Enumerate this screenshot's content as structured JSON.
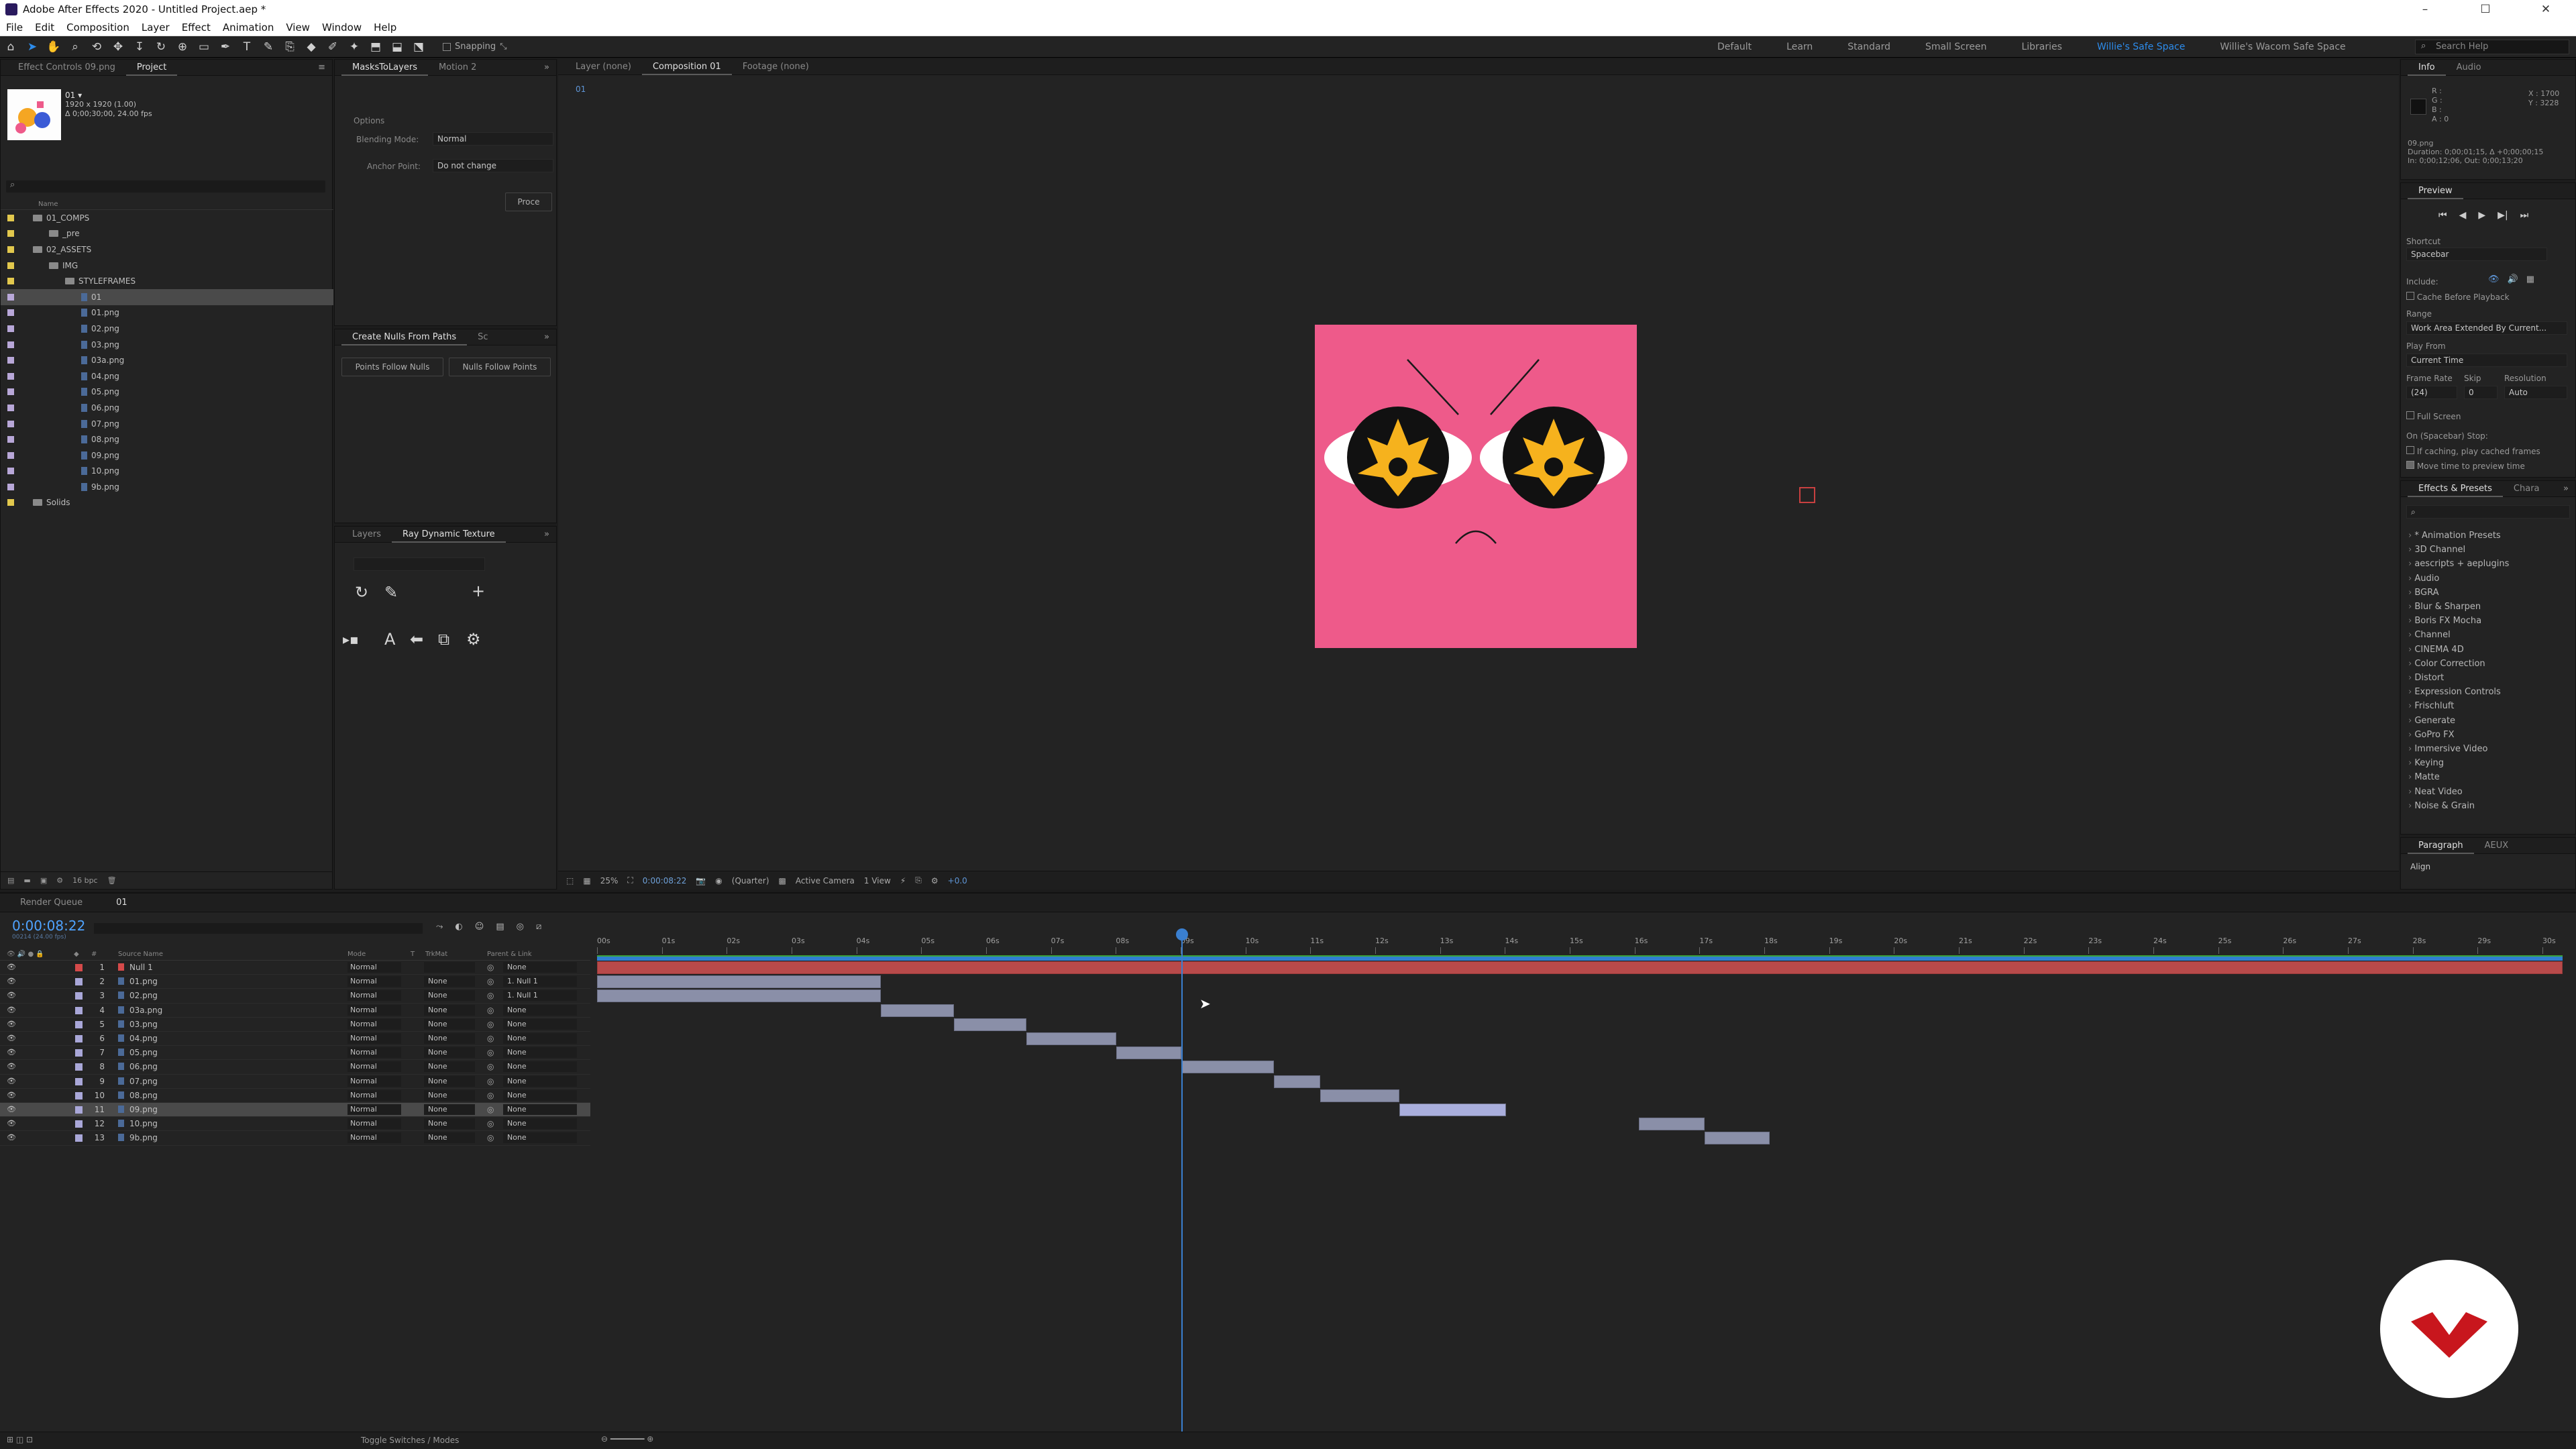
{
  "window": {
    "title": "Adobe After Effects 2020 - Untitled Project.aep *",
    "min": "–",
    "max": "☐",
    "close": "✕"
  },
  "menu": [
    "File",
    "Edit",
    "Composition",
    "Layer",
    "Effect",
    "Animation",
    "View",
    "Window",
    "Help"
  ],
  "toolbar": {
    "snapping": "Snapping",
    "workspaces": [
      "Default",
      "Learn",
      "Standard",
      "Small Screen",
      "Libraries",
      "Willie's Safe Space",
      "Willie's Wacom Safe Space"
    ],
    "active_workspace": "Willie's Safe Space",
    "search_placeholder": "Search Help"
  },
  "project": {
    "tabs": [
      "Effect Controls 09.png",
      "Project"
    ],
    "thumb_name": "01 ▾",
    "thumb_info": [
      "1920 x 1920 (1.00)",
      "Δ 0;00;30;00, 24.00 fps"
    ],
    "col_name": "Name",
    "items": [
      {
        "name": "01_COMPS",
        "kind": "folder",
        "indent": 1,
        "color": "#e2c84d"
      },
      {
        "name": "_pre",
        "kind": "folder",
        "indent": 2,
        "color": "#e2c84d"
      },
      {
        "name": "02_ASSETS",
        "kind": "folder",
        "indent": 1,
        "color": "#e2c84d"
      },
      {
        "name": "IMG",
        "kind": "folder",
        "indent": 2,
        "color": "#e2c84d"
      },
      {
        "name": "STYLEFRAMES",
        "kind": "folder",
        "indent": 3,
        "color": "#e2c84d"
      },
      {
        "name": "01",
        "kind": "file",
        "indent": 4,
        "color": "#b8a7d8",
        "selected": true
      },
      {
        "name": "01.png",
        "kind": "file",
        "indent": 4,
        "color": "#b8a7d8"
      },
      {
        "name": "02.png",
        "kind": "file",
        "indent": 4,
        "color": "#b8a7d8"
      },
      {
        "name": "03.png",
        "kind": "file",
        "indent": 4,
        "color": "#b8a7d8"
      },
      {
        "name": "03a.png",
        "kind": "file",
        "indent": 4,
        "color": "#b8a7d8"
      },
      {
        "name": "04.png",
        "kind": "file",
        "indent": 4,
        "color": "#b8a7d8"
      },
      {
        "name": "05.png",
        "kind": "file",
        "indent": 4,
        "color": "#b8a7d8"
      },
      {
        "name": "06.png",
        "kind": "file",
        "indent": 4,
        "color": "#b8a7d8"
      },
      {
        "name": "07.png",
        "kind": "file",
        "indent": 4,
        "color": "#b8a7d8"
      },
      {
        "name": "08.png",
        "kind": "file",
        "indent": 4,
        "color": "#b8a7d8"
      },
      {
        "name": "09.png",
        "kind": "file",
        "indent": 4,
        "color": "#b8a7d8"
      },
      {
        "name": "10.png",
        "kind": "file",
        "indent": 4,
        "color": "#b8a7d8"
      },
      {
        "name": "9b.png",
        "kind": "file",
        "indent": 4,
        "color": "#b8a7d8"
      },
      {
        "name": "Solids",
        "kind": "folder",
        "indent": 1,
        "color": "#e2c84d"
      }
    ],
    "bpc": "16 bpc"
  },
  "masks": {
    "tabs": [
      "MasksToLayers",
      "Motion 2"
    ],
    "options": "Options",
    "blending_label": "Blending Mode:",
    "blending_value": "Normal",
    "anchor_label": "Anchor Point:",
    "anchor_value": "Do not change",
    "process": "Proce"
  },
  "nulls": {
    "tabs": [
      "Create Nulls From Paths",
      "Sc"
    ],
    "points_follow_nulls": "Points Follow Nulls",
    "nulls_follow_points": "Nulls Follow Points"
  },
  "ray": {
    "tabs": [
      "Layers",
      "Ray Dynamic Texture"
    ]
  },
  "viewer": {
    "tabs": [
      "Layer (none)",
      "Composition 01",
      "Footage (none)"
    ],
    "comp_breadcrumb": "01",
    "zoom": "25%",
    "timecode": "0:00:08:22",
    "resolution": "(Quarter)",
    "camera": "Active Camera",
    "views": "1 View",
    "exposure": "+0.0"
  },
  "info": {
    "tabs": [
      "Info",
      "Audio"
    ],
    "rgba": [
      "R :",
      "G :",
      "B :",
      "A : 0"
    ],
    "xy": [
      "X : 1700",
      "Y : 3228"
    ],
    "clip_lines": [
      "09.png",
      "Duration: 0;00;01;15, Δ +0;00;00;15",
      "In: 0;00;12;06, Out: 0;00;13;20"
    ]
  },
  "preview": {
    "title": "Preview",
    "shortcut_label": "Shortcut",
    "shortcut_value": "Spacebar",
    "include_label": "Include:",
    "cache": "Cache Before Playback",
    "range_label": "Range",
    "range_value": "Work Area Extended By Current...",
    "play_from_label": "Play From",
    "play_from_value": "Current Time",
    "frame_rate_label": "Frame Rate",
    "skip_label": "Skip",
    "resolution_label": "Resolution",
    "frame_rate_value": "(24)",
    "skip_value": "0",
    "resolution_value": "Auto",
    "full_screen": "Full Screen",
    "stop_label": "On (Spacebar) Stop:",
    "if_caching": "If caching, play cached frames",
    "move_time": "Move time to preview time"
  },
  "effects": {
    "tabs": [
      "Effects & Presets",
      "Chara"
    ],
    "items": [
      "* Animation Presets",
      "3D Channel",
      "aescripts + aeplugins",
      "Audio",
      "BGRA",
      "Blur & Sharpen",
      "Boris FX Mocha",
      "Channel",
      "CINEMA 4D",
      "Color Correction",
      "Distort",
      "Expression Controls",
      "Frischluft",
      "Generate",
      "GoPro FX",
      "Immersive Video",
      "Keying",
      "Matte",
      "Neat Video",
      "Noise & Grain"
    ]
  },
  "paragraph": {
    "tabs": [
      "Paragraph",
      "AEUX"
    ],
    "align": "Align"
  },
  "timeline": {
    "tabs": [
      "Render Queue",
      "01"
    ],
    "timecode": "0:00:08:22",
    "timecode_sub": "00214 (24.00 fps)",
    "headers": {
      "source": "Source Name",
      "mode": "Mode",
      "t": "T",
      "trkmat": "TrkMat",
      "parent": "Parent & Link"
    },
    "ruler_ticks": [
      "00s",
      "01s",
      "02s",
      "03s",
      "04s",
      "05s",
      "06s",
      "07s",
      "08s",
      "09s",
      "10s",
      "11s",
      "12s",
      "13s",
      "14s",
      "15s",
      "16s",
      "17s",
      "18s",
      "19s",
      "20s",
      "21s",
      "22s",
      "23s",
      "24s",
      "25s",
      "26s",
      "27s",
      "28s",
      "29s",
      "30s"
    ],
    "toggle_label": "Toggle Switches / Modes",
    "layers": [
      {
        "num": "1",
        "name": "Null 1",
        "mode": "Normal",
        "trkmat": "",
        "parent": "None",
        "color": "#d54a4a",
        "null": true,
        "in": 0,
        "out": 30
      },
      {
        "num": "2",
        "name": "01.png",
        "mode": "Normal",
        "trkmat": "None",
        "parent": "1. Null 1",
        "color": "#a9a7d8",
        "in": 0,
        "out": 4.33
      },
      {
        "num": "3",
        "name": "02.png",
        "mode": "Normal",
        "trkmat": "None",
        "parent": "1. Null 1",
        "color": "#a9a7d8",
        "in": 0,
        "out": 4.33
      },
      {
        "num": "4",
        "name": "03a.png",
        "mode": "Normal",
        "trkmat": "None",
        "parent": "None",
        "color": "#a9a7d8",
        "in": 4.33,
        "out": 5.45
      },
      {
        "num": "5",
        "name": "03.png",
        "mode": "Normal",
        "trkmat": "None",
        "parent": "None",
        "color": "#a9a7d8",
        "in": 5.45,
        "out": 6.55
      },
      {
        "num": "6",
        "name": "04.png",
        "mode": "Normal",
        "trkmat": "None",
        "parent": "None",
        "color": "#a9a7d8",
        "in": 6.55,
        "out": 7.92
      },
      {
        "num": "7",
        "name": "05.png",
        "mode": "Normal",
        "trkmat": "None",
        "parent": "None",
        "color": "#a9a7d8",
        "in": 7.92,
        "out": 8.92
      },
      {
        "num": "8",
        "name": "06.png",
        "mode": "Normal",
        "trkmat": "None",
        "parent": "None",
        "color": "#a9a7d8",
        "in": 8.92,
        "out": 10.33
      },
      {
        "num": "9",
        "name": "07.png",
        "mode": "Normal",
        "trkmat": "None",
        "parent": "None",
        "color": "#a9a7d8",
        "in": 10.33,
        "out": 11.04
      },
      {
        "num": "10",
        "name": "08.png",
        "mode": "Normal",
        "trkmat": "None",
        "parent": "None",
        "color": "#a9a7d8",
        "in": 11.04,
        "out": 12.25
      },
      {
        "num": "11",
        "name": "09.png",
        "mode": "Normal",
        "trkmat": "None",
        "parent": "None",
        "color": "#a9a7d8",
        "in": 12.25,
        "out": 13.875,
        "selected": true
      },
      {
        "num": "12",
        "name": "10.png",
        "mode": "Normal",
        "trkmat": "None",
        "parent": "None",
        "color": "#a9a7d8",
        "in": 15.9,
        "out": 16.9
      },
      {
        "num": "13",
        "name": "9b.png",
        "mode": "Normal",
        "trkmat": "None",
        "parent": "None",
        "color": "#a9a7d8",
        "in": 16.9,
        "out": 17.9
      }
    ],
    "current_time": 8.92,
    "duration": 30
  }
}
